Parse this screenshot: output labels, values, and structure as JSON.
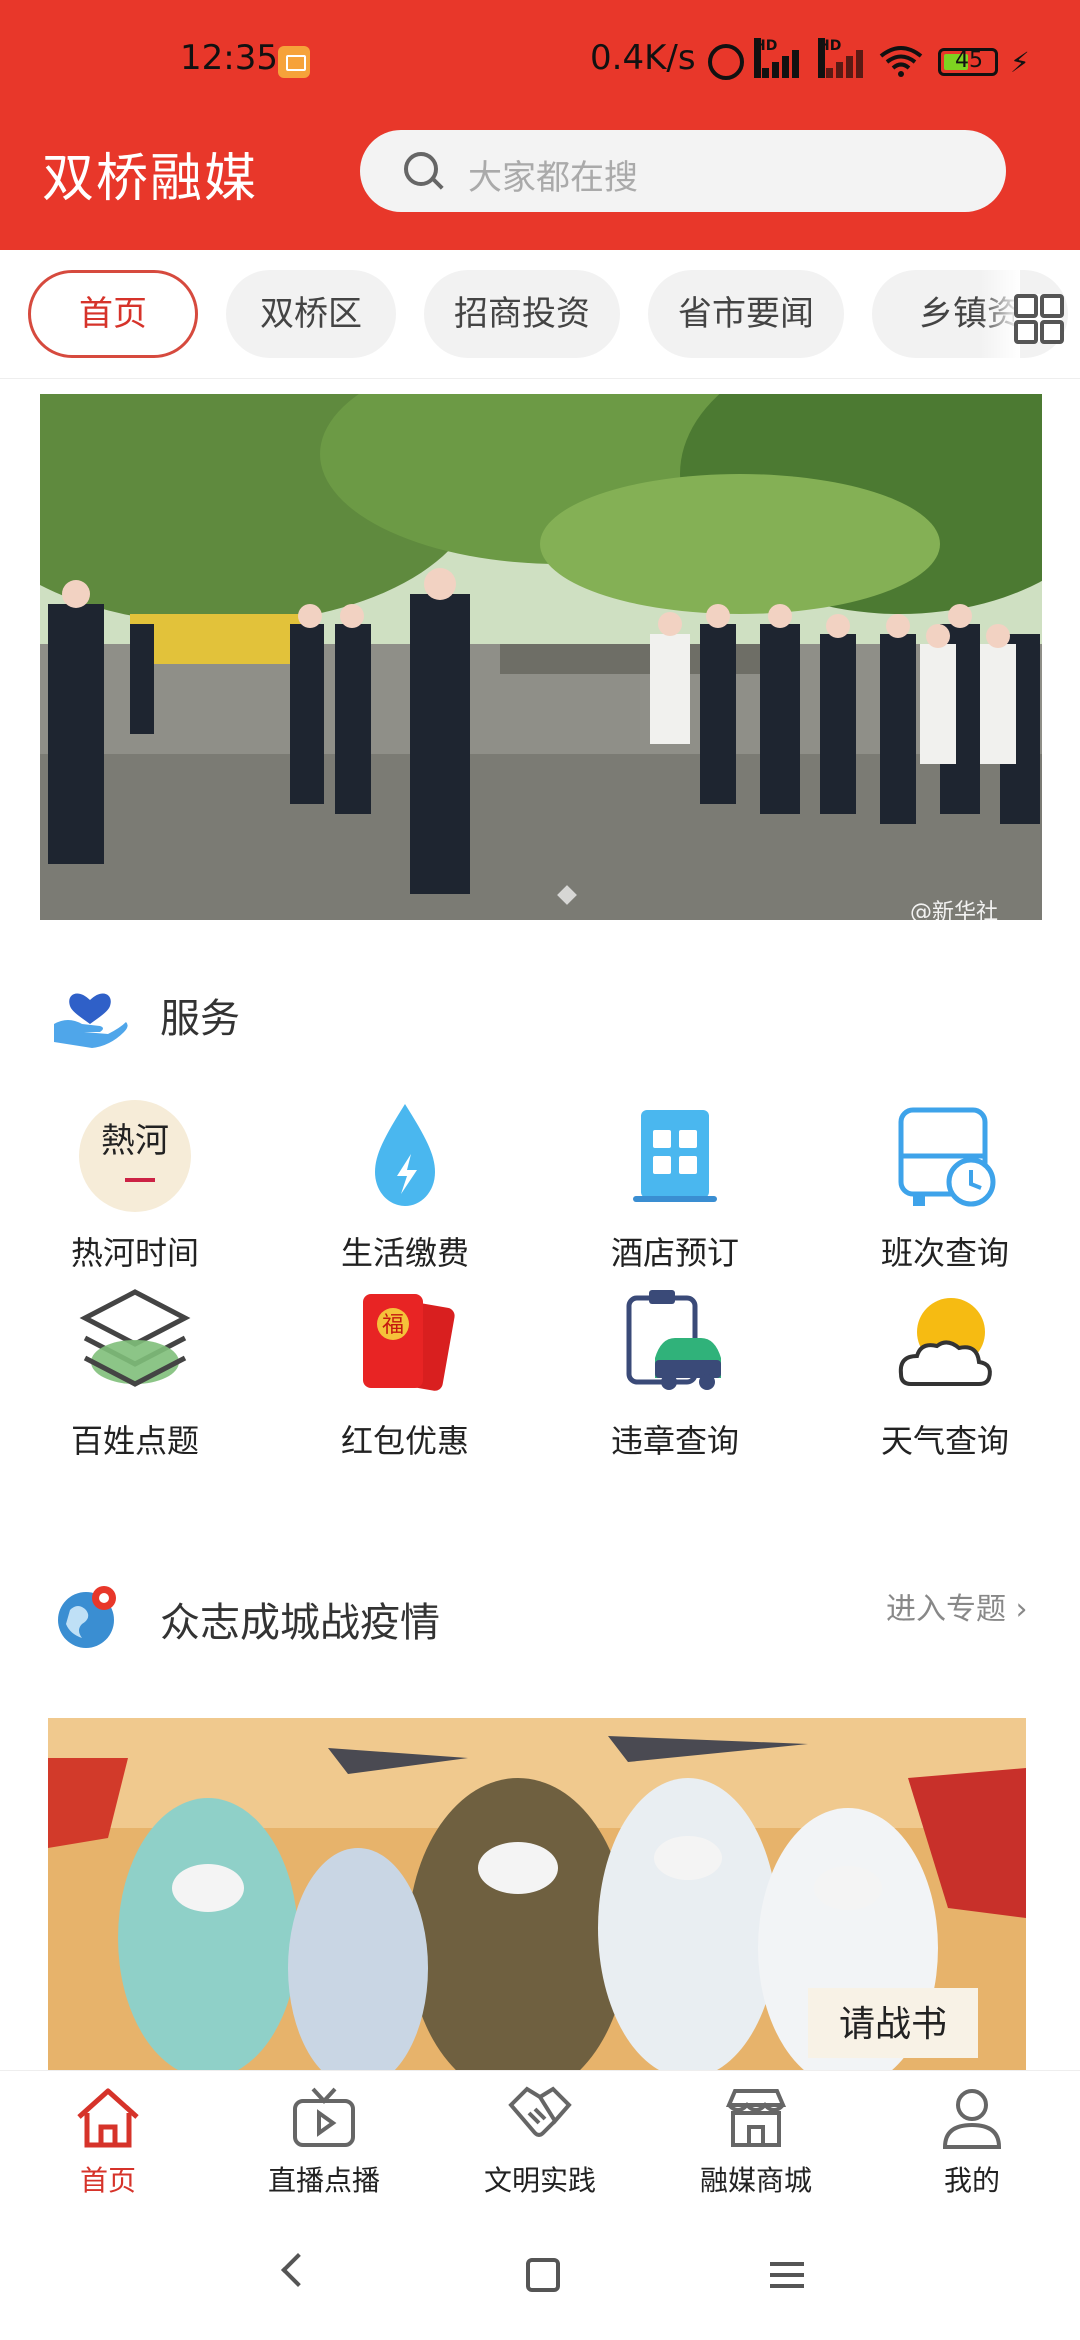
{
  "status_bar": {
    "time": "12:35",
    "network_speed": "0.4K/s",
    "battery": "45",
    "hd1": "HD",
    "hd2": "HD"
  },
  "header": {
    "app_title": "双桥融媒",
    "search_placeholder": "大家都在搜"
  },
  "tabs": [
    {
      "label": "首页",
      "active": true
    },
    {
      "label": "双桥区"
    },
    {
      "label": "招商投资"
    },
    {
      "label": "省市要闻"
    },
    {
      "label": "乡镇资"
    }
  ],
  "hero": {
    "watermark": "@新华社"
  },
  "services": {
    "title": "服务",
    "items": [
      {
        "label": "热河时间",
        "icon": "rehe-time-icon",
        "badge_text": "熱河"
      },
      {
        "label": "生活缴费",
        "icon": "water-drop-icon"
      },
      {
        "label": "酒店预订",
        "icon": "hotel-building-icon"
      },
      {
        "label": "班次查询",
        "icon": "bus-clock-icon"
      },
      {
        "label": "百姓点题",
        "icon": "layers-icon"
      },
      {
        "label": "红包优惠",
        "icon": "red-packet-icon",
        "badge_text": "福"
      },
      {
        "label": "违章查询",
        "icon": "car-clipboard-icon"
      },
      {
        "label": "天气查询",
        "icon": "weather-icon"
      }
    ]
  },
  "epidemic": {
    "title": "众志成城战疫情",
    "more": "进入专题",
    "banner_text": "请战书"
  },
  "bottom_nav": [
    {
      "label": "首页",
      "icon": "home-icon",
      "active": true
    },
    {
      "label": "直播点播",
      "icon": "tv-play-icon"
    },
    {
      "label": "文明实践",
      "icon": "handshake-icon"
    },
    {
      "label": "融媒商城",
      "icon": "shop-icon"
    },
    {
      "label": "我的",
      "icon": "user-icon"
    }
  ],
  "colors": {
    "brand_red": "#e8372a",
    "active_red": "#d6332a"
  }
}
